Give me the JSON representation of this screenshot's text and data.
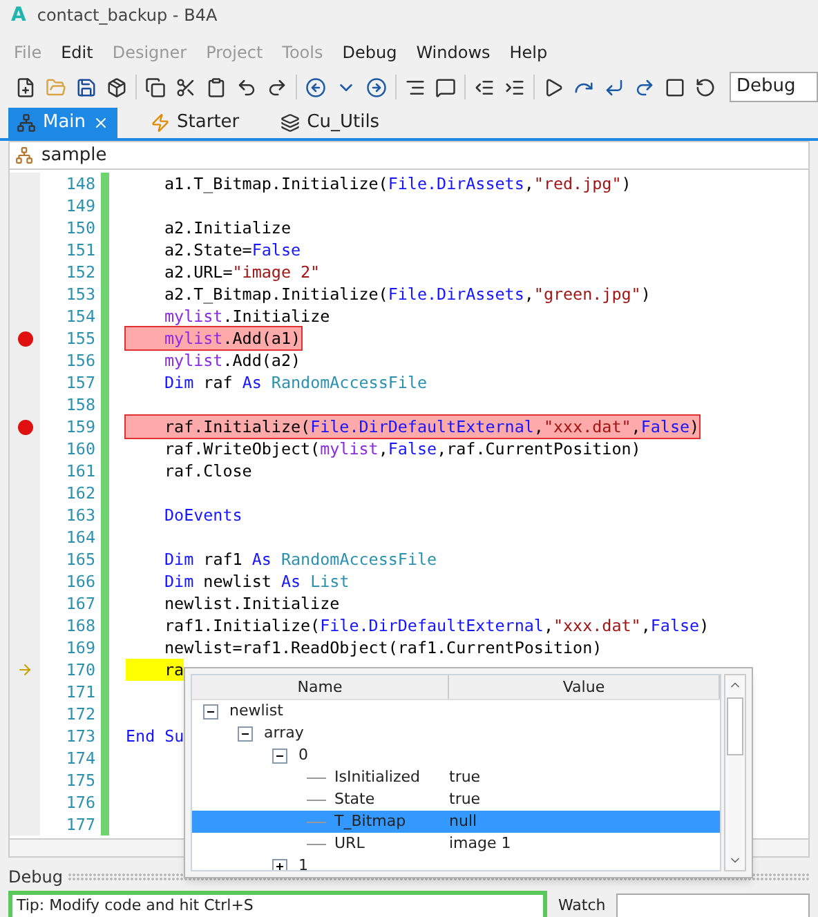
{
  "window": {
    "title": "contact_backup - B4A",
    "app_letter": "A"
  },
  "menu": [
    {
      "label": "File",
      "disabled": true
    },
    {
      "label": "Edit",
      "disabled": false
    },
    {
      "label": "Designer",
      "disabled": true
    },
    {
      "label": "Project",
      "disabled": true
    },
    {
      "label": "Tools",
      "disabled": true
    },
    {
      "label": "Debug",
      "disabled": false
    },
    {
      "label": "Windows",
      "disabled": false
    },
    {
      "label": "Help",
      "disabled": false
    }
  ],
  "build_config": {
    "value": "Debug"
  },
  "tabs": [
    {
      "label": "Main",
      "selected": true,
      "kind": "main"
    },
    {
      "label": "Starter",
      "selected": false,
      "kind": "service"
    },
    {
      "label": "Cu_Utils",
      "selected": false,
      "kind": "class"
    }
  ],
  "breadcrumb": {
    "label": "sample"
  },
  "code_lines": [
    {
      "number": "148",
      "breakpoint": false,
      "current": false,
      "indented": true,
      "tokens": [
        {
          "text": "a1.T_Bitmap.Initialize(",
          "kind": "plain"
        },
        {
          "text": "File.DirAssets",
          "kind": "keyword"
        },
        {
          "text": ",",
          "kind": "plain"
        },
        {
          "text": "\"red.jpg\"",
          "kind": "string"
        },
        {
          "text": ")",
          "kind": "plain"
        }
      ]
    },
    {
      "number": "149",
      "breakpoint": false,
      "current": false
    },
    {
      "number": "150",
      "breakpoint": false,
      "current": false,
      "indented": true,
      "tokens": [
        {
          "text": "a2.Initialize",
          "kind": "plain"
        }
      ]
    },
    {
      "number": "151",
      "breakpoint": false,
      "current": false,
      "indented": true,
      "tokens": [
        {
          "text": "a2.State=",
          "kind": "plain"
        },
        {
          "text": "False",
          "kind": "keyword"
        }
      ]
    },
    {
      "number": "152",
      "breakpoint": false,
      "current": false,
      "indented": true,
      "tokens": [
        {
          "text": "a2.URL=",
          "kind": "plain"
        },
        {
          "text": "\"image 2\"",
          "kind": "string"
        }
      ]
    },
    {
      "number": "153",
      "breakpoint": false,
      "current": false,
      "indented": true,
      "tokens": [
        {
          "text": "a2.T_Bitmap.Initialize(",
          "kind": "plain"
        },
        {
          "text": "File.DirAssets",
          "kind": "keyword"
        },
        {
          "text": ",",
          "kind": "plain"
        },
        {
          "text": "\"green.jpg\"",
          "kind": "string"
        },
        {
          "text": ")",
          "kind": "plain"
        }
      ]
    },
    {
      "number": "154",
      "breakpoint": false,
      "current": false,
      "indented": true,
      "tokens": [
        {
          "text": "mylist",
          "kind": "variable"
        },
        {
          "text": ".Initialize",
          "kind": "plain"
        }
      ]
    },
    {
      "number": "155",
      "breakpoint": true,
      "current": false,
      "indented": true,
      "tokens": [
        {
          "text": "mylist",
          "kind": "variable"
        },
        {
          "text": ".Add(a1)",
          "kind": "plain"
        }
      ]
    },
    {
      "number": "156",
      "breakpoint": false,
      "current": false,
      "indented": true,
      "tokens": [
        {
          "text": "mylist",
          "kind": "variable"
        },
        {
          "text": ".Add(a2)",
          "kind": "plain"
        }
      ]
    },
    {
      "number": "157",
      "breakpoint": false,
      "current": false,
      "indented": true,
      "tokens": [
        {
          "text": "Dim",
          "kind": "keyword"
        },
        {
          "text": " raf ",
          "kind": "plain"
        },
        {
          "text": "As",
          "kind": "keyword"
        },
        {
          "text": " RandomAccessFile",
          "kind": "type"
        }
      ]
    },
    {
      "number": "158",
      "breakpoint": false,
      "current": false
    },
    {
      "number": "159",
      "breakpoint": true,
      "current": false,
      "indented": true,
      "tokens": [
        {
          "text": "raf.Initialize(",
          "kind": "plain"
        },
        {
          "text": "File.DirDefaultExternal",
          "kind": "keyword"
        },
        {
          "text": ",",
          "kind": "plain"
        },
        {
          "text": "\"xxx.dat\"",
          "kind": "string"
        },
        {
          "text": ",",
          "kind": "plain"
        },
        {
          "text": "False",
          "kind": "keyword"
        },
        {
          "text": ")",
          "kind": "plain"
        }
      ]
    },
    {
      "number": "160",
      "breakpoint": false,
      "current": false,
      "indented": true,
      "tokens": [
        {
          "text": "raf.WriteObject(",
          "kind": "plain"
        },
        {
          "text": "mylist",
          "kind": "variable"
        },
        {
          "text": ",",
          "kind": "plain"
        },
        {
          "text": "False",
          "kind": "keyword"
        },
        {
          "text": ",raf.CurrentPosition)",
          "kind": "plain"
        }
      ]
    },
    {
      "number": "161",
      "breakpoint": false,
      "current": false,
      "indented": true,
      "tokens": [
        {
          "text": "raf.Close",
          "kind": "plain"
        }
      ]
    },
    {
      "number": "162",
      "breakpoint": false,
      "current": false
    },
    {
      "number": "163",
      "breakpoint": false,
      "current": false,
      "indented": true,
      "tokens": [
        {
          "text": "DoEvents",
          "kind": "keyword"
        }
      ]
    },
    {
      "number": "164",
      "breakpoint": false,
      "current": false
    },
    {
      "number": "165",
      "breakpoint": false,
      "current": false,
      "indented": true,
      "tokens": [
        {
          "text": "Dim",
          "kind": "keyword"
        },
        {
          "text": " raf1 ",
          "kind": "plain"
        },
        {
          "text": "As",
          "kind": "keyword"
        },
        {
          "text": " RandomAccessFile",
          "kind": "type"
        }
      ]
    },
    {
      "number": "166",
      "breakpoint": false,
      "current": false,
      "indented": true,
      "tokens": [
        {
          "text": "Dim",
          "kind": "keyword"
        },
        {
          "text": " newlist ",
          "kind": "plain"
        },
        {
          "text": "As",
          "kind": "keyword"
        },
        {
          "text": " List",
          "kind": "type"
        }
      ]
    },
    {
      "number": "167",
      "breakpoint": false,
      "current": false,
      "indented": true,
      "tokens": [
        {
          "text": "newlist.Initialize",
          "kind": "plain"
        }
      ]
    },
    {
      "number": "168",
      "breakpoint": false,
      "current": false,
      "indented": true,
      "tokens": [
        {
          "text": "raf1.Initialize(",
          "kind": "plain"
        },
        {
          "text": "File.DirDefaultExternal",
          "kind": "keyword"
        },
        {
          "text": ",",
          "kind": "plain"
        },
        {
          "text": "\"xxx.dat\"",
          "kind": "string"
        },
        {
          "text": ",",
          "kind": "plain"
        },
        {
          "text": "False",
          "kind": "keyword"
        },
        {
          "text": ")",
          "kind": "plain"
        }
      ]
    },
    {
      "number": "169",
      "breakpoint": false,
      "current": false,
      "indented": true,
      "tokens": [
        {
          "text": "newlist=raf1.ReadObject(raf1.CurrentPosition)",
          "kind": "plain"
        }
      ]
    },
    {
      "number": "170",
      "breakpoint": false,
      "current": true,
      "indented": true,
      "tokens": [
        {
          "text": "ra",
          "kind": "plain"
        }
      ]
    },
    {
      "number": "171",
      "breakpoint": false,
      "current": false
    },
    {
      "number": "172",
      "breakpoint": false,
      "current": false
    },
    {
      "number": "173",
      "breakpoint": false,
      "current": false,
      "indented": false,
      "tokens": [
        {
          "text": "End Su",
          "kind": "keyword"
        }
      ]
    },
    {
      "number": "174",
      "breakpoint": false,
      "current": false
    },
    {
      "number": "175",
      "breakpoint": false,
      "current": false
    },
    {
      "number": "176",
      "breakpoint": false,
      "current": false
    },
    {
      "number": "177",
      "breakpoint": false,
      "current": false
    }
  ],
  "inspector": {
    "columns": [
      "Name",
      "Value"
    ],
    "tree": [
      {
        "name": "newlist",
        "expanded": true,
        "children": [
          {
            "name": "array",
            "expanded": true,
            "children": [
              {
                "name": "0",
                "expanded": true,
                "children": [
                  {
                    "name": "IsInitialized",
                    "value": "true",
                    "selected": false
                  },
                  {
                    "name": "State",
                    "value": "true",
                    "selected": false
                  },
                  {
                    "name": "T_Bitmap",
                    "value": "null",
                    "selected": true
                  },
                  {
                    "name": "URL",
                    "value": "image 1",
                    "selected": false
                  }
                ]
              },
              {
                "name": "1",
                "expanded": false
              }
            ]
          }
        ]
      }
    ]
  },
  "debug_panel": {
    "title": "Debug",
    "tip": "Tip: Modify code and hit Ctrl+S",
    "watch_label": "Watch"
  }
}
